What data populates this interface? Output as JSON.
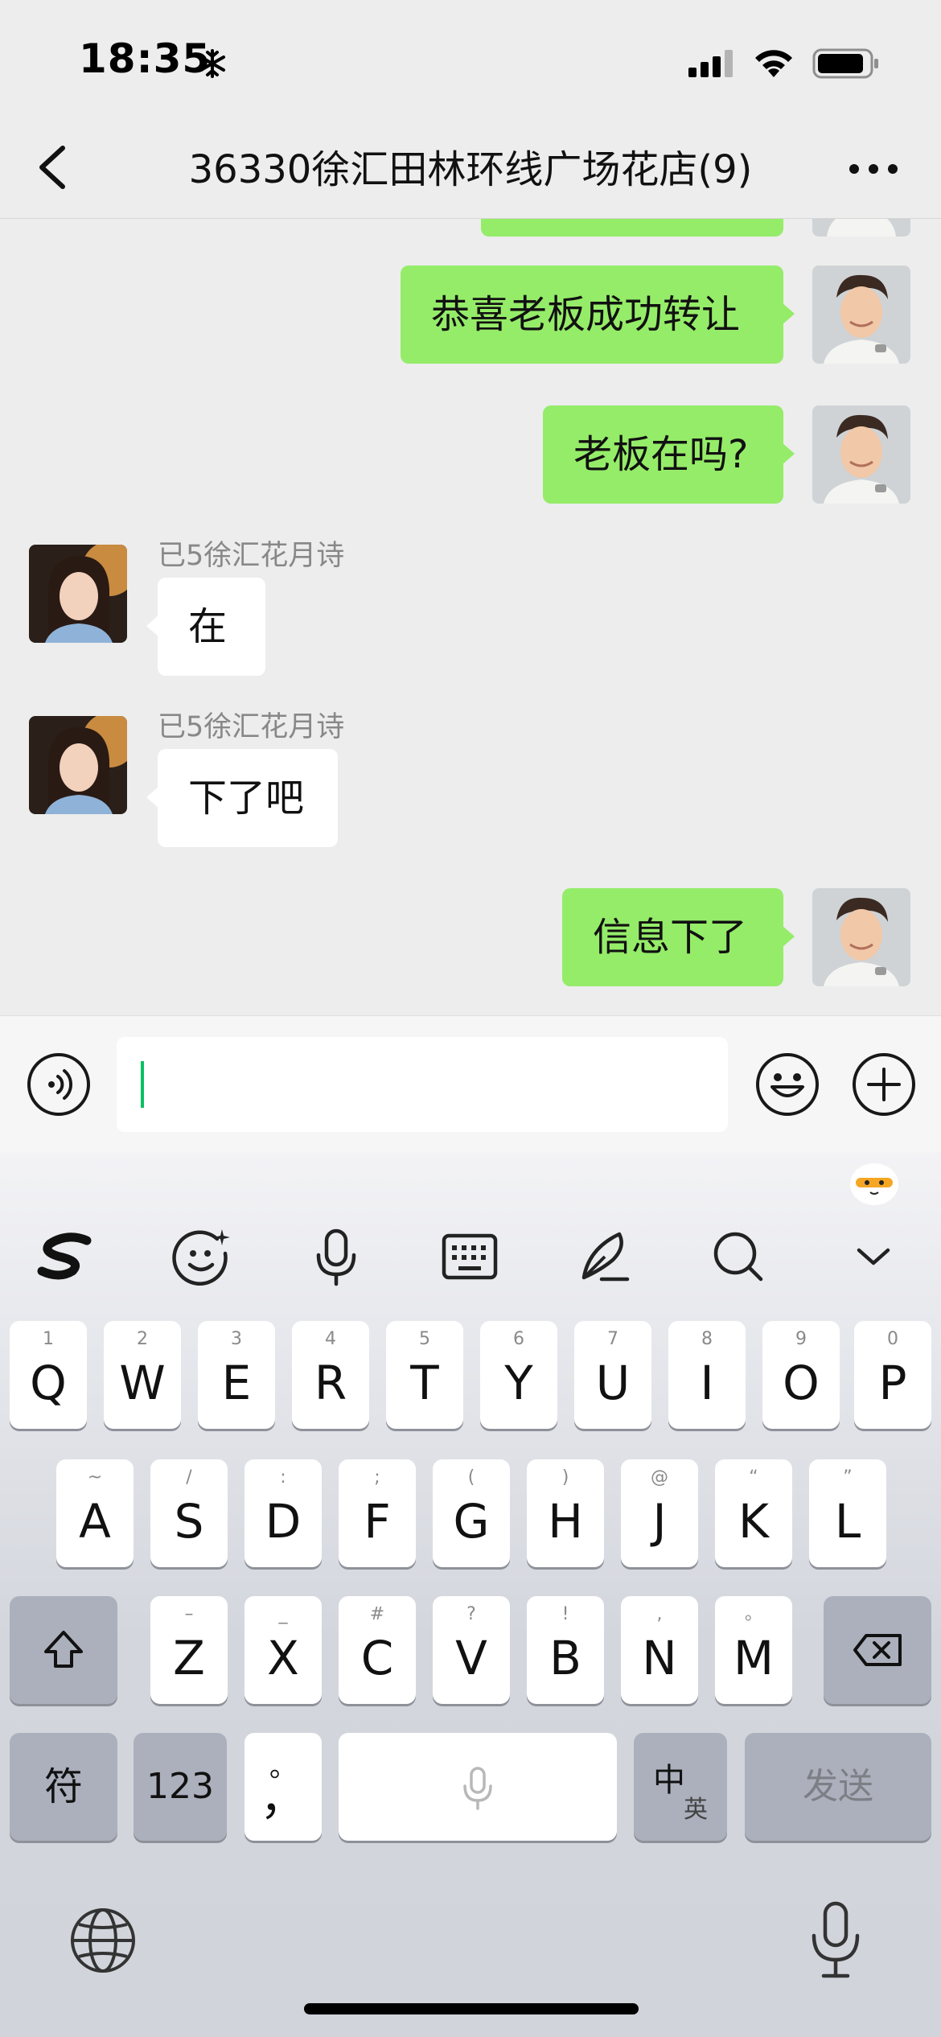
{
  "status_bar": {
    "time": "18:35"
  },
  "nav": {
    "title": "36330徐汇田林环线广场花店(9)"
  },
  "chat": {
    "messages": [
      {
        "sender": "me",
        "text": "恭喜老板成功转让"
      },
      {
        "sender": "me",
        "text": "老板在吗?"
      },
      {
        "sender": "other",
        "name": "已5徐汇花月诗",
        "text": "在"
      },
      {
        "sender": "other",
        "name": "已5徐汇花月诗",
        "text": "下了吧"
      },
      {
        "sender": "me",
        "text": "信息下了"
      }
    ]
  },
  "input": {
    "value": ""
  },
  "keyboard": {
    "row1": [
      {
        "main": "Q",
        "sub": "1"
      },
      {
        "main": "W",
        "sub": "2"
      },
      {
        "main": "E",
        "sub": "3"
      },
      {
        "main": "R",
        "sub": "4"
      },
      {
        "main": "T",
        "sub": "5"
      },
      {
        "main": "Y",
        "sub": "6"
      },
      {
        "main": "U",
        "sub": "7"
      },
      {
        "main": "I",
        "sub": "8"
      },
      {
        "main": "O",
        "sub": "9"
      },
      {
        "main": "P",
        "sub": "0"
      }
    ],
    "row2": [
      {
        "main": "A",
        "sub": "~"
      },
      {
        "main": "S",
        "sub": "/"
      },
      {
        "main": "D",
        "sub": ":"
      },
      {
        "main": "F",
        "sub": ";"
      },
      {
        "main": "G",
        "sub": "("
      },
      {
        "main": "H",
        "sub": ")"
      },
      {
        "main": "J",
        "sub": "@"
      },
      {
        "main": "K",
        "sub": "“"
      },
      {
        "main": "L",
        "sub": "”"
      }
    ],
    "row3": [
      {
        "main": "Z",
        "sub": "–"
      },
      {
        "main": "X",
        "sub": "_"
      },
      {
        "main": "C",
        "sub": "#"
      },
      {
        "main": "V",
        "sub": "?"
      },
      {
        "main": "B",
        "sub": "!"
      },
      {
        "main": "N",
        "sub": ","
      },
      {
        "main": "M",
        "sub": "。"
      }
    ],
    "symbol_key": "符",
    "number_key": "123",
    "punct_key": {
      "main": "，",
      "sub": "。"
    },
    "lang_key": {
      "primary": "中",
      "secondary": "英"
    },
    "send_key": "发送"
  }
}
